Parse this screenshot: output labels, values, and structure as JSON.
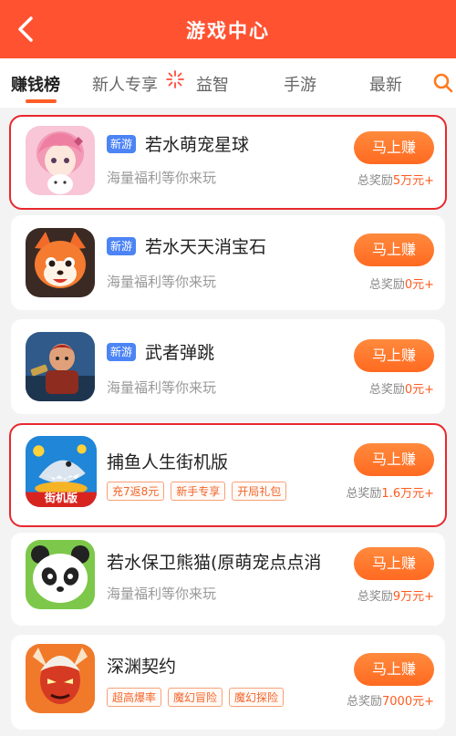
{
  "header": {
    "title": "游戏中心"
  },
  "tabs": [
    {
      "label": "赚钱榜"
    },
    {
      "label": "新人专享"
    },
    {
      "label": "益智"
    },
    {
      "label": "手游"
    },
    {
      "label": "最新"
    }
  ],
  "colors": {
    "header_bg": "#ff5231",
    "accent": "#ff6a21",
    "new_badge": "#4c84f5",
    "highlight_box": "#e8282e"
  },
  "games": [
    {
      "name": "若水萌宠星球",
      "badge": "新游",
      "subtitle": "海量福利等你来玩",
      "tags": [],
      "button": "马上赚",
      "reward_prefix": "总奖励",
      "reward_amount": "5万元+",
      "highlighted": true,
      "icon": "pink-anime-girl-icon"
    },
    {
      "name": "若水天天消宝石",
      "badge": "新游",
      "subtitle": "海量福利等你来玩",
      "tags": [],
      "button": "马上赚",
      "reward_prefix": "总奖励",
      "reward_amount": "0元+",
      "highlighted": false,
      "icon": "fox-mascot-icon"
    },
    {
      "name": "武者弹跳",
      "badge": "新游",
      "subtitle": "海量福利等你来玩",
      "tags": [],
      "button": "马上赚",
      "reward_prefix": "总奖励",
      "reward_amount": "0元+",
      "highlighted": false,
      "icon": "warrior-icon"
    },
    {
      "name": "捕鱼人生街机版",
      "badge": "",
      "subtitle": "",
      "tags": [
        "充7返8元",
        "新手专享",
        "开局礼包"
      ],
      "button": "马上赚",
      "reward_prefix": "总奖励",
      "reward_amount": "1.6万元+",
      "highlighted": true,
      "icon": "fishing-shark-icon",
      "icon_caption": "街机版"
    },
    {
      "name": "若水保卫熊猫(原萌宠点点消",
      "badge": "",
      "subtitle": "海量福利等你来玩",
      "tags": [],
      "button": "马上赚",
      "reward_prefix": "总奖励",
      "reward_amount": "9万元+",
      "highlighted": false,
      "icon": "panda-icon"
    },
    {
      "name": "深渊契约",
      "badge": "",
      "subtitle": "",
      "tags": [
        "超高爆率",
        "魔幻冒险",
        "魔幻探险"
      ],
      "button": "马上赚",
      "reward_prefix": "总奖励",
      "reward_amount": "7000元+",
      "highlighted": false,
      "icon": "demon-warrior-icon"
    }
  ]
}
